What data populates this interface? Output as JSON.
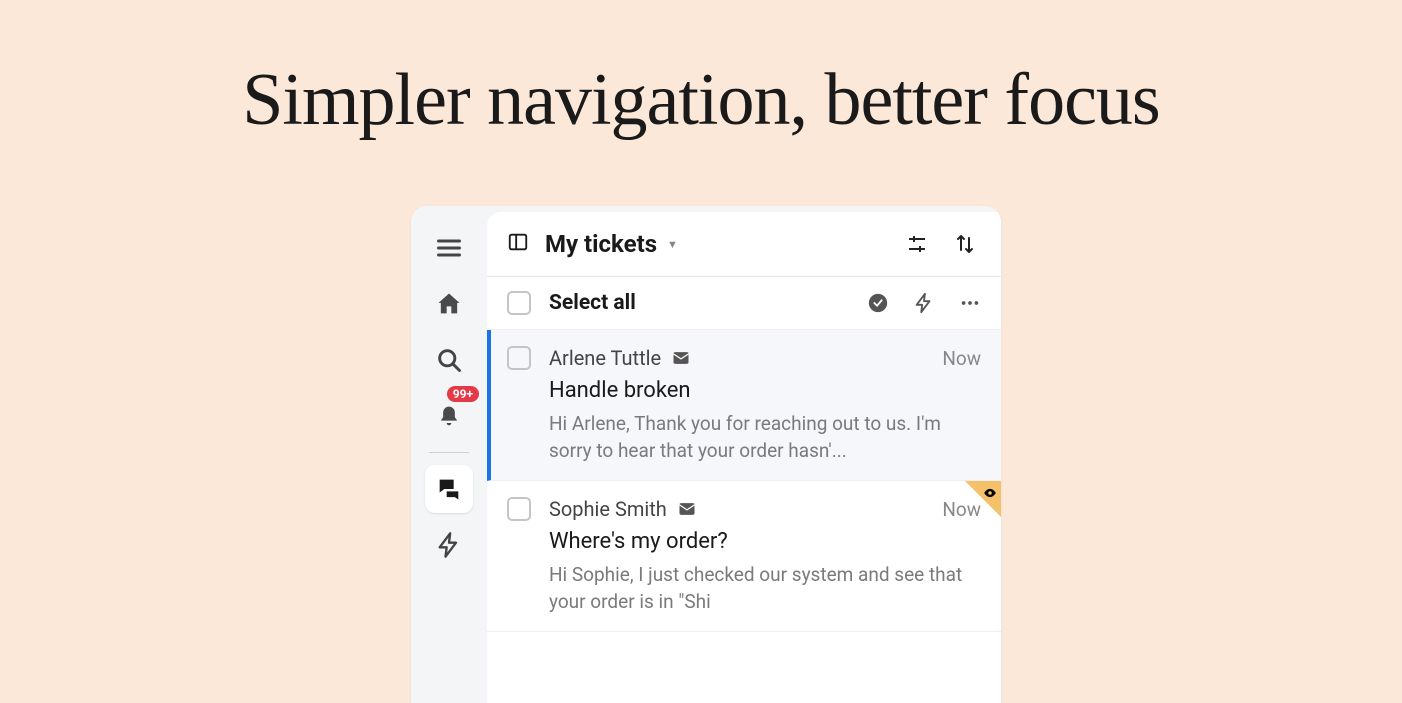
{
  "headline": "Simpler navigation, better focus",
  "sidebar": {
    "notification_badge": "99+"
  },
  "panel": {
    "view_title": "My tickets",
    "select_all_label": "Select all"
  },
  "tickets": [
    {
      "customer": "Arlene Tuttle",
      "time": "Now",
      "subject": "Handle broken",
      "preview": "Hi Arlene, Thank you for reaching out to us. I'm sorry to hear that your order hasn'..."
    },
    {
      "customer": "Sophie Smith",
      "time": "Now",
      "subject": "Where's my order?",
      "preview": "Hi Sophie, I just checked our system and see that your order is in \"Shi"
    }
  ]
}
